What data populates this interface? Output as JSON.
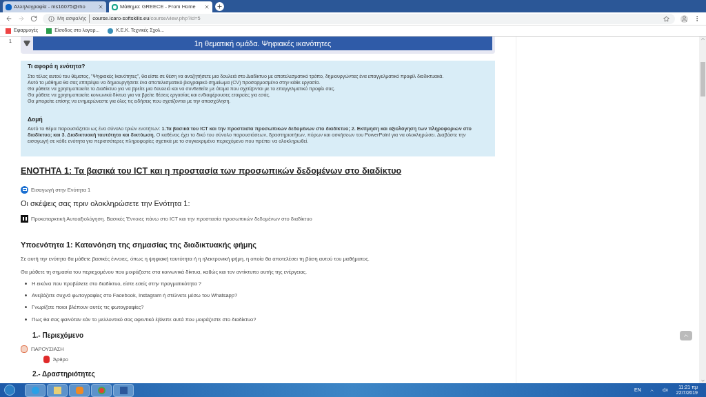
{
  "browser": {
    "tabs": [
      {
        "label": "Αλληλογραφία - ms16075@rho",
        "selected": false
      },
      {
        "label": "Μάθημα: GREECE - From Home",
        "selected": true
      }
    ],
    "address": {
      "security": "Μη ασφαλής",
      "domain": "course.icaro-softskills.eu",
      "path": "/course/view.php?id=5"
    },
    "bookmarks": [
      "Εφαρμογές",
      "Είσοδος στο λογαρ...",
      "Κ.Ε.Κ. Τεχνικές Σχολ..."
    ]
  },
  "page": {
    "section_number": "1",
    "section_title": "1η θεματική ομάδα. Ψηφιακές ικανότητες",
    "collapsed": false,
    "summary": {
      "heading": "Τι αφορά η ενότητα?",
      "lines": [
        "Στο τέλος αυτού του θέματος, \"Ψηφιακές Ικανότητες\", θα είστε σε θέση να αναζητήσετε μια δουλειά στο Διαδίκτυο με αποτελεσματικό τρόπο, δημιουργώντας ένα επαγγελματικό προφίλ διαδικτυακά.",
        "Αυτό το μάθημα θα σας επιτρέψει να δημιουργήσετε ένα αποτελεσματικό βιογραφικό σημείωμα  (CV) προσαρμοσμένο στην κάθε εργασία.",
        "Θα μάθετε να χρησιμοποιείτε το Διαδίκτυο για να βρείτε μια δουλειά και να συνδεθείτε με άτομα που σχετίζονται με το επαγγελματικό προφίλ σας.",
        "Θα μάθετε να χρησιμοποιείτε κοινωνικά δίκτυα για να βρείτε θέσεις εργασίας και ενδιαφέρουσες εταιρείες για εσάς.",
        "Θα μπορείτε επίσης να ενημερώνεστε για όλες τις ειδήσεις που σχετίζονται με την απασχόληση."
      ],
      "structure_heading": "Δομή",
      "structure_text": "Αυτό το θέμα παρουσιάζεται ως ένα σύνολο τριών ενοτήτων: **1.Τα βασικά του  ICT  και την προστασία προσωπικών δεδομένων στο διαδίκτυο; 2. Εκτίμηση και αξιολόγηση των πληροφοριών στο διαδίκτυο; και 3. Διαδικτυακή ταυτότητα και δικτύωση.** Ο καθένας έχει το δικό του σύνολο παρουσιάσεων, δραστηριοτήτων, πόρων και ασκήσεων του PowerPoint για να ολοκληρώσει. Διαβάστε την εισαγωγή σε κάθε ενότητα για περισσότερες πληροφορίες σχετικά με το συγκεκριμένο περιεχόμενο που πρέπει να ολοκληρωθεί."
    },
    "unit_heading": "ΕΝΟΤΗΤΑ 1: Τα βασικά του  ICT  και η προστασία των προσωπικών δεδομένων στο διαδίκτυο",
    "intro_link": "Εισαγωγή στην Ενότητα 1",
    "thoughts_heading": "Οι σκέψεις σας πριν ολοκληρώσετε την Ενότητα 1:",
    "self_assessment_link": "Προκαταρκτική Αυτοαξιολόγηση. Βασικές Έννοιες πάνω στο ICT και την προστασία προσωπικών δεδομένων στο διαδίκτυο",
    "subunit_heading": "Υποενότητα 1: Κατανόηση της σημασίας της διαδικτυακής φήμης",
    "paragraphs": [
      "Σε αυτή την ενότητα θα μάθετε βασικές έννοιες, όπως η ψηφιακή ταυτότητα ή η ηλεκτρονική φήμη, η οποία θα αποτελέσει τη βάση αυτού του μαθήματος.",
      "Θα μάθετε τη σημασία του περιεχομένου που μοιράζεστε στα κοινωνικά δίκτυα, καθώς και τον αντίκτυπο αυτής της ενέργειας."
    ],
    "questions": [
      "Η εικόνα που προβάλετε στο διαδίκτυο, είστε εσείς στην πραγματικότητα ?",
      "Ανεβάζετε συχνά φωτογραφίες στο  Facebook, Instagram ή στέλνετε μέσω του Whatsapp?",
      "Γνωρίζετε ποιοι βλέπουν αυτές τις φωτογραφίες?",
      "Πως θα σας φαινόταν εάν το μελλοντικό σας αφεντικό έβλεπε αυτά που μοιράζεστε στο διαδίκτυο?"
    ],
    "content_heading": "1.- Περιεχόμενο",
    "presentation_link": "ΠΑΡΟΥΣΙΑΣΗ",
    "article_link": "Άρθρο",
    "activities_heading": "2.- Δραστηριότητες"
  },
  "taskbar": {
    "language": "EN",
    "time": "11:21 πμ",
    "date": "22/7/2019"
  }
}
